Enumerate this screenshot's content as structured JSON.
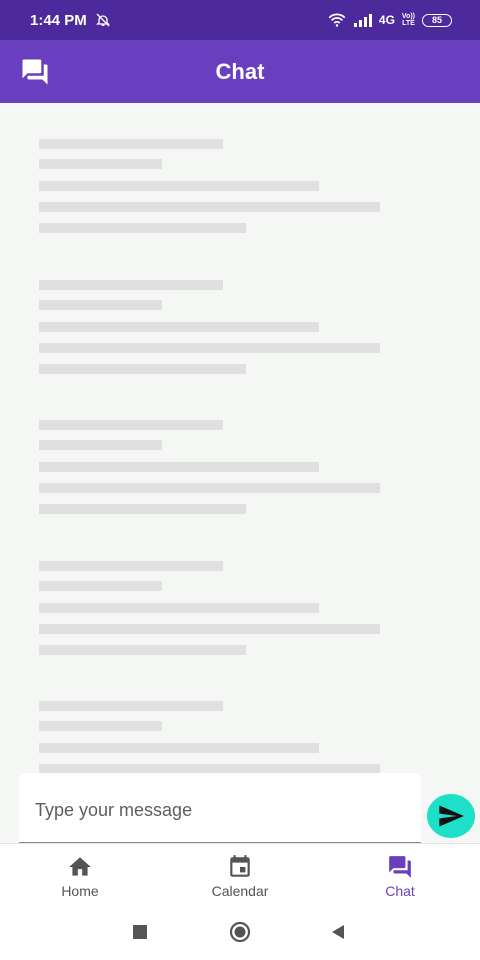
{
  "status_bar": {
    "time": "1:44 PM",
    "network": "4G",
    "volte_top": "Vo))",
    "volte_bottom": "LTE",
    "battery": "85",
    "icons": [
      "alarm-off-icon",
      "wifi-icon",
      "signal-icon",
      "battery-icon"
    ]
  },
  "app_bar": {
    "title": "Chat",
    "icon": "forum-icon"
  },
  "composer": {
    "placeholder": "Type your message",
    "value": "",
    "send_icon": "send-icon"
  },
  "bottom_nav": {
    "items": [
      {
        "label": "Home",
        "icon": "home-icon",
        "active": false
      },
      {
        "label": "Calendar",
        "icon": "calendar-icon",
        "active": false
      },
      {
        "label": "Chat",
        "icon": "forum-icon",
        "active": true
      }
    ]
  },
  "system_nav": {
    "icons": [
      "recents-square-icon",
      "home-circle-icon",
      "back-triangle-icon"
    ]
  },
  "colors": {
    "status_bar": "#4c2a9c",
    "app_bar": "#6a3fbf",
    "accent": "#6a3fbf",
    "send_button": "#1ee0c8",
    "background": "#f4f7f4",
    "skeleton": "#e0e0e0"
  }
}
